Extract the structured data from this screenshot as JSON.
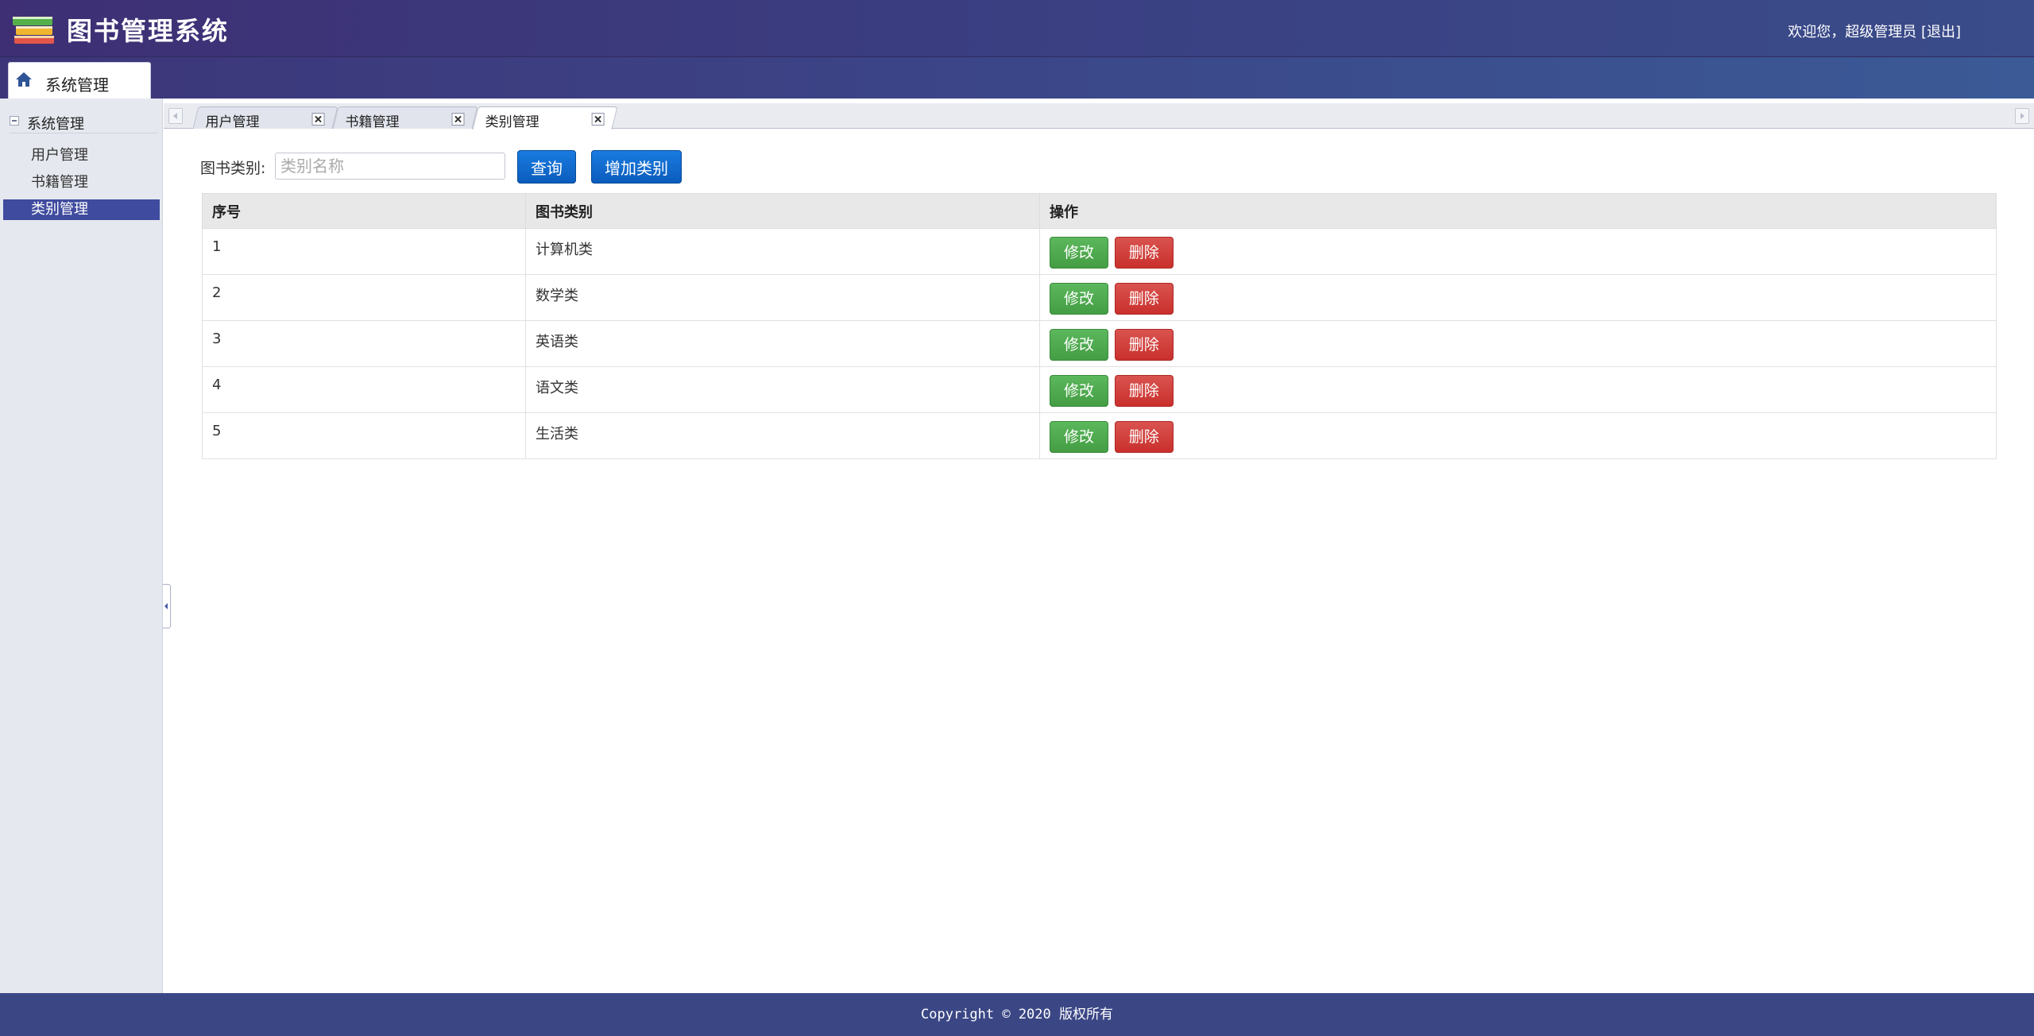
{
  "header": {
    "title": "图书管理系统",
    "welcome": "欢迎您，超级管理员",
    "logout": "[退出]"
  },
  "topnav": {
    "tab_label": "系统管理",
    "icon": "home-icon"
  },
  "sidebar": {
    "group_label": "系统管理",
    "items": [
      {
        "label": "用户管理",
        "active": false
      },
      {
        "label": "书籍管理",
        "active": false
      },
      {
        "label": "类别管理",
        "active": true
      }
    ]
  },
  "tabs": [
    {
      "label": "用户管理",
      "active": false
    },
    {
      "label": "书籍管理",
      "active": false
    },
    {
      "label": "类别管理",
      "active": true
    }
  ],
  "search": {
    "label": "图书类别:",
    "placeholder": "类别名称",
    "value": "",
    "query_button": "查询",
    "add_button": "增加类别"
  },
  "table": {
    "headers": [
      "序号",
      "图书类别",
      "操作"
    ],
    "edit_label": "修改",
    "delete_label": "删除",
    "rows": [
      {
        "id": "1",
        "category": "计算机类"
      },
      {
        "id": "2",
        "category": "数学类"
      },
      {
        "id": "3",
        "category": "英语类"
      },
      {
        "id": "4",
        "category": "语文类"
      },
      {
        "id": "5",
        "category": "生活类"
      }
    ]
  },
  "footer": {
    "text": "Copyright © 2020 版权所有"
  },
  "colors": {
    "header": "#3e2f74",
    "sidebar_active": "#3f4b9e",
    "primary_button": "#0a5cbc",
    "edit_button": "#5cb85c",
    "delete_button": "#d9534f",
    "footer": "#3b4785"
  }
}
